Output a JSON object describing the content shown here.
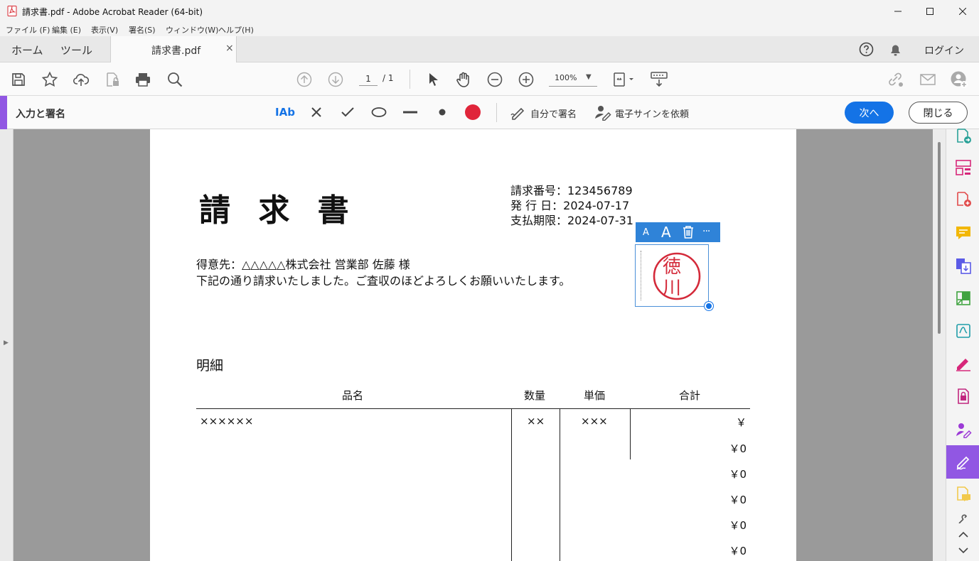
{
  "window": {
    "title": "請求書.pdf - Adobe Acrobat Reader (64-bit)",
    "controls": [
      "minimize",
      "maximize",
      "close"
    ]
  },
  "menu": {
    "items": [
      "ファイル (F)",
      "編集 (E)",
      "表示(V)",
      "署名(S)",
      "ウィンドウ(W)",
      "ヘルプ(H)"
    ]
  },
  "tabs": {
    "home": "ホーム",
    "tools": "ツール",
    "document": "請求書.pdf",
    "close_glyph": "×",
    "login": "ログイン"
  },
  "toolbar": {
    "page_current": "1",
    "page_total": "/ 1",
    "zoom": "100%",
    "icons": [
      "save-icon",
      "star-icon",
      "cloud-upload-icon",
      "lock-document-icon",
      "print-icon",
      "search-zoom-icon",
      "page-up-icon",
      "page-down-icon",
      "select-cursor-icon",
      "hand-icon",
      "zoom-out-icon",
      "zoom-in-icon",
      "fit-page-icon",
      "scroll-mode-icon",
      "share-link-icon",
      "mail-icon",
      "add-user-icon"
    ]
  },
  "fill_sign": {
    "mode_label": "入力と署名",
    "text_tool": "IAb",
    "sign_self": "自分で署名",
    "request_esign": "電子サインを依頼",
    "next": "次へ",
    "close": "閉じる",
    "color_accent": "#e0253a"
  },
  "document": {
    "title": "請 求 書",
    "meta": [
      "請求番号：123456789",
      "発 行 日：2024-07-17",
      "支払期限：2024-07-31"
    ],
    "recipient": "得意先：△△△△△株式会社 営業部 佐藤 様",
    "message": "下記の通り請求いたしました。ご査収のほどよろしくお願いいたします。",
    "section": "明細",
    "table": {
      "headers": [
        "品名",
        "数量",
        "単価",
        "合計"
      ],
      "rows": [
        {
          "item": "××××××",
          "qty": "××",
          "price": "×××",
          "total": "￥"
        },
        {
          "item": "",
          "qty": "",
          "price": "",
          "total": "￥0"
        },
        {
          "item": "",
          "qty": "",
          "price": "",
          "total": "￥0"
        },
        {
          "item": "",
          "qty": "",
          "price": "",
          "total": "￥0"
        },
        {
          "item": "",
          "qty": "",
          "price": "",
          "total": "￥0"
        },
        {
          "item": "",
          "qty": "",
          "price": "",
          "total": "￥0"
        }
      ]
    },
    "stamp": {
      "line1": "徳",
      "line2": "川",
      "color": "#d42a3a",
      "toolbar": {
        "small": "A",
        "large": "A",
        "more": "···"
      }
    }
  },
  "right_panel": {
    "icons": [
      "export-pdf-icon",
      "organize-pages-icon",
      "create-pdf-icon",
      "comment-icon",
      "combine-files-icon",
      "compress-icon",
      "convert-icon",
      "edit-pdf-icon",
      "protect-icon",
      "request-signature-icon",
      "fill-sign-icon",
      "send-comments-icon",
      "more-tools-icon"
    ],
    "active": "fill-sign-icon"
  }
}
